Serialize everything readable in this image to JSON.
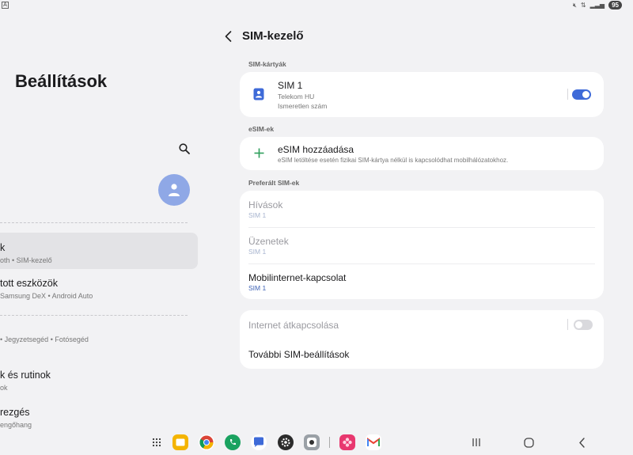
{
  "status_bar": {
    "battery": "95"
  },
  "left_panel": {
    "title": "Beállítások",
    "items": [
      {
        "title": "k",
        "subtitle": "oth  •  SIM-kezelő"
      },
      {
        "title": "tott eszközök",
        "subtitle": "Samsung DeX  •  Android Auto"
      },
      {
        "title": "",
        "subtitle": "•  Jegyzetsegéd  •  Fotósegéd"
      },
      {
        "title": "k és rutinok",
        "subtitle": "ok"
      },
      {
        "title": "rezgés",
        "subtitle": "engőhang"
      }
    ]
  },
  "header": {
    "title": "SIM-kezelő"
  },
  "sections": {
    "sim_cards": "SIM-kártyák",
    "esims": "eSIM-ek",
    "preferred": "Preferált SIM-ek"
  },
  "sim1": {
    "title": "SIM 1",
    "carrier": "Telekom HU",
    "number": "Ismeretlen szám",
    "enabled": true
  },
  "esim_add": {
    "title": "eSIM hozzáadása",
    "description": "eSIM letöltése esetén fizikai SIM-kártya nélkül is kapcsolódhat mobilhálózatokhoz."
  },
  "preferred": {
    "calls": {
      "title": "Hívások",
      "value": "SIM 1"
    },
    "messages": {
      "title": "Üzenetek",
      "value": "SIM 1"
    },
    "mobile_data": {
      "title": "Mobilinternet-kapcsolat",
      "value": "SIM 1"
    }
  },
  "internet_switch": {
    "title": "Internet átkapcsolása",
    "enabled": false
  },
  "more_settings": {
    "title": "További SIM-beállítások"
  },
  "colors": {
    "accent": "#3e6ad8",
    "background": "#f2f2f4",
    "card": "#ffffff",
    "avatar": "#8fa8e6"
  }
}
